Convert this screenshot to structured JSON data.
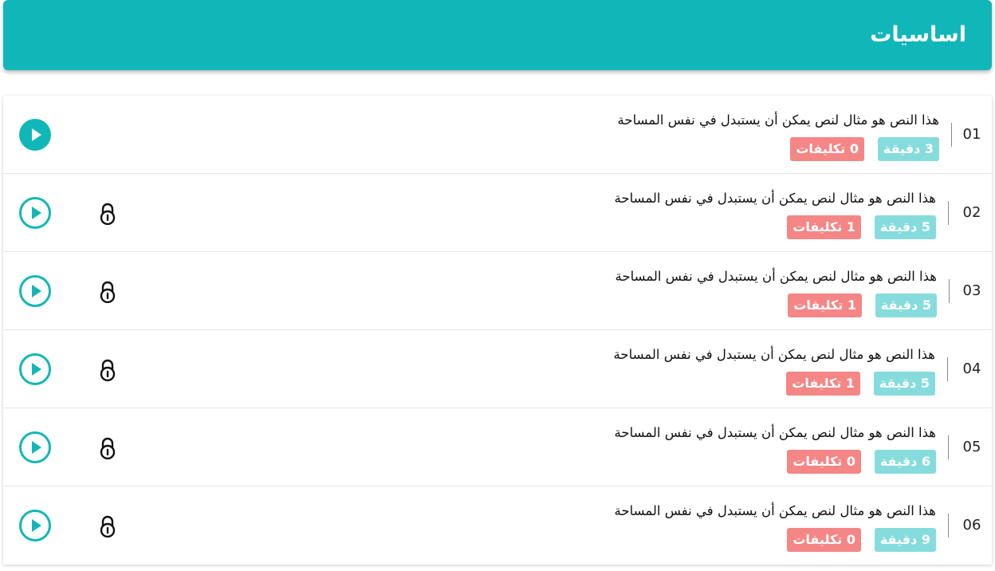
{
  "header": {
    "title": "اساسيات"
  },
  "colors": {
    "accent": "#11b7b8",
    "minutes_badge": "#86dcdc",
    "tasks_badge": "#f58686"
  },
  "lessons": [
    {
      "number": "01",
      "title": "هذا النص هو مثال لنص يمكن أن يستبدل في نفس المساحة",
      "minutes": "3 دقيقة",
      "tasks": "0 تكليفات",
      "locked": false,
      "play_icon": "play-filled-icon"
    },
    {
      "number": "02",
      "title": "هذا النص هو مثال لنص يمكن أن يستبدل في نفس المساحة",
      "minutes": "5 دقيقة",
      "tasks": "1 تكليفات",
      "locked": true,
      "play_icon": "play-outline-icon"
    },
    {
      "number": "03",
      "title": "هذا النص هو مثال لنص يمكن أن يستبدل في نفس المساحة",
      "minutes": "5 دقيقة",
      "tasks": "1 تكليفات",
      "locked": true,
      "play_icon": "play-outline-icon"
    },
    {
      "number": "04",
      "title": "هذا النص هو مثال لنص يمكن أن يستبدل في نفس المساحة",
      "minutes": "5 دقيقة",
      "tasks": "1 تكليفات",
      "locked": true,
      "play_icon": "play-outline-icon"
    },
    {
      "number": "05",
      "title": "هذا النص هو مثال لنص يمكن أن يستبدل في نفس المساحة",
      "minutes": "6 دقيقة",
      "tasks": "0 تكليفات",
      "locked": true,
      "play_icon": "play-outline-icon"
    },
    {
      "number": "06",
      "title": "هذا النص هو مثال لنص يمكن أن يستبدل في نفس المساحة",
      "minutes": "9 دقيقة",
      "tasks": "0 تكليفات",
      "locked": true,
      "play_icon": "play-outline-icon"
    }
  ]
}
